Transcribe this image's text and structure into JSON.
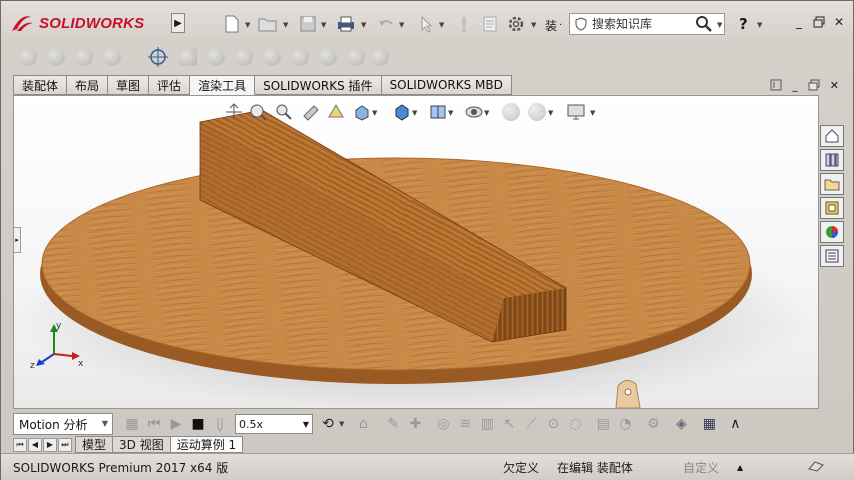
{
  "app": {
    "brand": "SOLIDWORKS",
    "truncated_menu": "装",
    "search_placeholder": "搜索知识库",
    "help": "?"
  },
  "tabs": [
    {
      "label": "装配体"
    },
    {
      "label": "布局"
    },
    {
      "label": "草图"
    },
    {
      "label": "评估"
    },
    {
      "label": "渲染工具"
    },
    {
      "label": "SOLIDWORKS 插件"
    },
    {
      "label": "SOLIDWORKS MBD"
    }
  ],
  "motion": {
    "study_type": "Motion 分析",
    "speed": "0.5x"
  },
  "model_tabs": [
    {
      "label": "模型"
    },
    {
      "label": "3D 视图"
    },
    {
      "label": "运动算例 1"
    }
  ],
  "status": {
    "product": "SOLIDWORKS Premium 2017 x64 版",
    "definition": "欠定义",
    "editing": "在编辑 装配体",
    "custom": "自定义"
  },
  "colors": {
    "brand_red": "#c8102e",
    "wood_light": "#c98a48",
    "wood_dark": "#7a4416"
  }
}
